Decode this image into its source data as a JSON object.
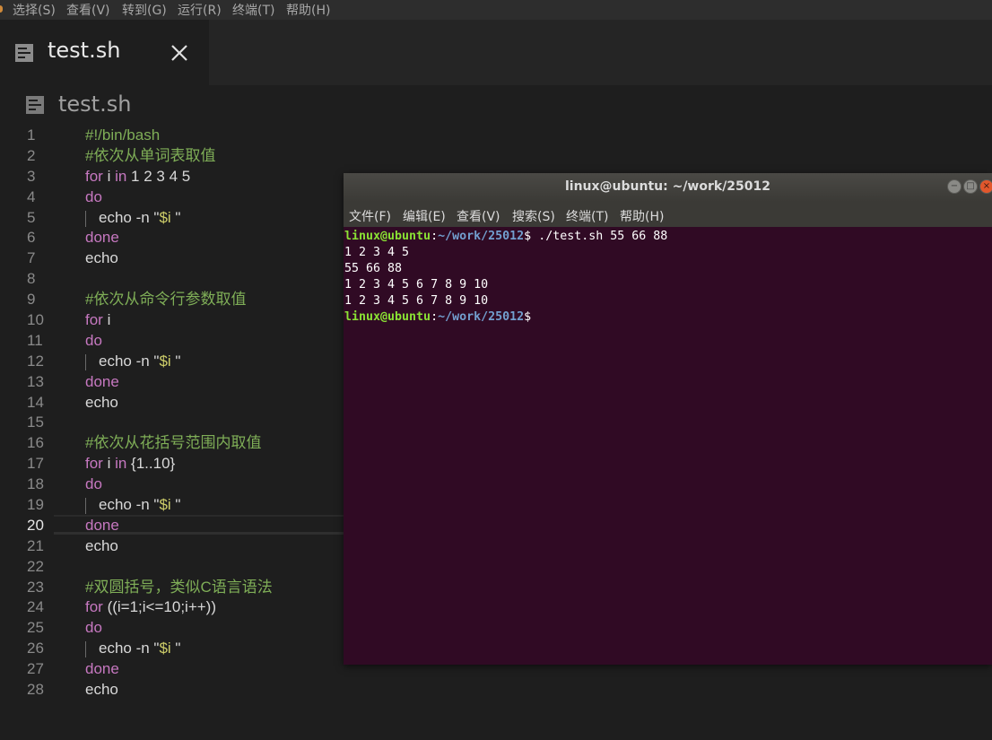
{
  "menubar": {
    "items": [
      "选择(S)",
      "查看(V)",
      "转到(G)",
      "运行(R)",
      "终端(T)",
      "帮助(H)"
    ]
  },
  "tab": {
    "title": "test.sh"
  },
  "editor": {
    "header_title": "test.sh",
    "current_line": 20,
    "line_numbers": [
      "1",
      "2",
      "3",
      "4",
      "5",
      "6",
      "7",
      "8",
      "9",
      "10",
      "11",
      "12",
      "13",
      "14",
      "15",
      "16",
      "17",
      "18",
      "19",
      "20",
      "21",
      "22",
      "23",
      "24",
      "25",
      "26",
      "27",
      "28"
    ],
    "lines": [
      {
        "comment": "#!/bin/bash"
      },
      {
        "comment": "#依次从单词表取值"
      },
      {
        "kw": "for",
        "rest": " i ",
        "kw2": "in",
        "rest2": " 1 2 3 4 5"
      },
      {
        "kw": "do"
      },
      {
        "indent": true,
        "rest": "echo -n \"",
        "var": "$i",
        "rest2": " \""
      },
      {
        "kw": "done"
      },
      {
        "rest": "echo"
      },
      {},
      {
        "comment": "#依次从命令行参数取值"
      },
      {
        "kw": "for",
        "rest": " i"
      },
      {
        "kw": "do"
      },
      {
        "indent": true,
        "rest": "echo -n \"",
        "var": "$i",
        "rest2": " \""
      },
      {
        "kw": "done"
      },
      {
        "rest": "echo"
      },
      {},
      {
        "comment": "#依次从花括号范围内取值"
      },
      {
        "kw": "for",
        "rest": " i ",
        "kw2": "in",
        "rest2": " {1..10}"
      },
      {
        "kw": "do"
      },
      {
        "indent": true,
        "rest": "echo -n \"",
        "var": "$i",
        "rest2": " \""
      },
      {
        "kw": "done"
      },
      {
        "rest": "echo"
      },
      {},
      {
        "comment": "#双圆括号，类似C语言语法"
      },
      {
        "kw": "for",
        "rest": " ((i=1;i<=10;i++))"
      },
      {
        "kw": "do"
      },
      {
        "indent": true,
        "rest": "echo -n \"",
        "var": "$i",
        "rest2": " \""
      },
      {
        "kw": "done"
      },
      {
        "rest": "echo"
      }
    ]
  },
  "terminal": {
    "title": "linux@ubuntu: ~/work/25012",
    "window_buttons": {
      "minimize": "−",
      "maximize": "□",
      "close": "×"
    },
    "menu": [
      "文件(F)",
      "编辑(E)",
      "查看(V)",
      "搜索(S)",
      "终端(T)",
      "帮助(H)"
    ],
    "lines": [
      {
        "prompt_user": "linux@ubuntu",
        "prompt_sep": ":",
        "prompt_path": "~/work/25012",
        "prompt_end": "$ ",
        "text": "./test.sh 55 66 88"
      },
      {
        "text": "1 2 3 4 5"
      },
      {
        "text": "55 66 88"
      },
      {
        "text": "1 2 3 4 5 6 7 8 9 10"
      },
      {
        "text": "1 2 3 4 5 6 7 8 9 10"
      },
      {
        "prompt_user": "linux@ubuntu",
        "prompt_sep": ":",
        "prompt_path": "~/work/25012",
        "prompt_end": "$",
        "text": ""
      }
    ]
  },
  "colors": {
    "editor_bg": "#1e1e1e",
    "comment": "#7fae57",
    "keyword": "#c678c0",
    "variable": "#cfcf6a",
    "terminal_bg": "#300a24",
    "prompt_user": "#8ae234",
    "prompt_path": "#729fcf"
  }
}
